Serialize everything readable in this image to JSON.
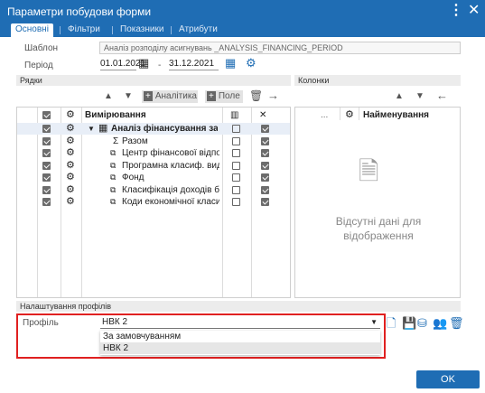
{
  "window": {
    "title": "Параметри побудови форми"
  },
  "tabs": [
    "Основні",
    "Фільтри",
    "Показники",
    "Атрибути"
  ],
  "template": {
    "label": "Шаблон",
    "value": "Аналіз розподілу асигнувань _ANALYSIS_FINANCING_PERIOD"
  },
  "period": {
    "label": "Період",
    "from": "01.01.2021",
    "sep": "-",
    "to": "31.12.2021"
  },
  "rows_section": {
    "title": "Рядки",
    "btn_analytics": "Аналітика",
    "btn_field": "Поле",
    "col_header": "Вимірювання"
  },
  "tree_rows": [
    {
      "label": "Аналіз фінансування за пері",
      "level": 0,
      "bold": true,
      "c1": true,
      "c3": false,
      "c4": true
    },
    {
      "label": "Разом",
      "level": 1,
      "icon": "Σ",
      "c1": true,
      "c3": false,
      "c4": true
    },
    {
      "label": "Центр фінансової відповід",
      "level": 1,
      "icon": "tree",
      "c1": true,
      "c3": false,
      "c4": true
    },
    {
      "label": "Програмна класиф. видат",
      "level": 1,
      "icon": "tree",
      "c1": true,
      "c3": false,
      "c4": true
    },
    {
      "label": "Фонд",
      "level": 1,
      "icon": "tree",
      "c1": true,
      "c3": false,
      "c4": true
    },
    {
      "label": "Класифікація доходів бюд",
      "level": 1,
      "icon": "tree",
      "c1": true,
      "c3": false,
      "c4": true
    },
    {
      "label": "Коди економічної класиф",
      "level": 1,
      "icon": "tree",
      "c1": true,
      "c3": false,
      "c4": true
    }
  ],
  "columns_section": {
    "title": "Колонки",
    "col_header": "Найменування",
    "dots": "...",
    "empty_line1": "Відсутні дані для",
    "empty_line2": "відображення"
  },
  "profile_section": {
    "title": "Налаштування профілів",
    "label": "Профіль",
    "value": "НВК 2",
    "options": [
      "За замовчуванням",
      "НВК 2"
    ]
  },
  "ok_label": "OK",
  "colors": {
    "accent": "#1f6db4",
    "highlight": "#e02020"
  }
}
